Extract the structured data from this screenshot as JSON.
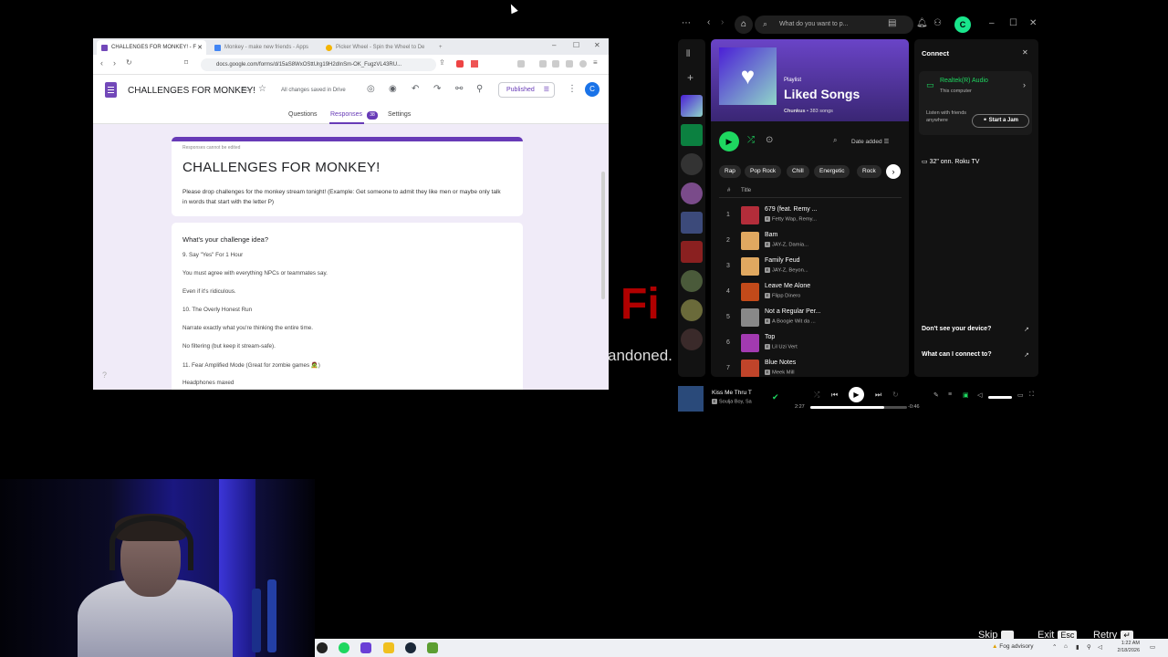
{
  "chrome": {
    "tabs": [
      {
        "label": "CHALLENGES FOR MONKEY! - F",
        "favicon_color": "#7248b9"
      },
      {
        "label": "Monkey - make new friends - Apps",
        "favicon_color": "#4285f4"
      },
      {
        "label": "Picker Wheel - Spin the Wheel to De",
        "favicon_color": "#f4b400"
      }
    ],
    "new_tab": "+",
    "url": "docs.google.com/forms/d/15aS8WxOSttUrg19H2dInSm-OK_FugzVL43RU..."
  },
  "forms": {
    "title": "CHALLENGES FOR MONKEY!",
    "saved_status": "All changes saved in Drive",
    "publish_label": "Published",
    "account_initial": "C",
    "tabs": {
      "questions": "Questions",
      "responses": "Responses",
      "responses_count": "38",
      "settings": "Settings"
    },
    "notice": "Responses cannot be edited",
    "form_heading": "CHALLENGES FOR MONKEY!",
    "description": "Please drop challenges for the monkey stream tonight! (Example: Get someone to admit they like men or maybe only talk in words that start with the letter P)",
    "question": "What's your challenge idea?",
    "answer_lines": [
      "9. Say \"Yes\" For 1 Hour",
      "You must agree with everything NPCs or teammates say.",
      "Even if it's ridiculous.",
      "10. The Overly Honest Run",
      "Narrate exactly what you're thinking the entire time.",
      "No filtering (but keep it stream-safe).",
      "11. Fear Amplified Mode (Great for zombie games 🧟)",
      "Headphones maxed"
    ]
  },
  "background_text": {
    "fragment_red": "Fi",
    "fragment_white": "andoned."
  },
  "spotify": {
    "search_placeholder": "What do you want to p...",
    "avatar_initial": "C",
    "playlist": {
      "type": "Playlist",
      "title": "Liked Songs",
      "owner": "Chunkus",
      "count": "383 songs"
    },
    "sort_label": "Date added",
    "chips": [
      "Rap",
      "Pop Rock",
      "Chill",
      "Energetic",
      "Rock"
    ],
    "col_hash": "#",
    "col_title": "Title",
    "tracks": [
      {
        "num": "1",
        "title": "679 (feat. Remy ...",
        "artist": "Fetty Wap, Remy...",
        "color": "#b32d3a"
      },
      {
        "num": "2",
        "title": "Bam",
        "artist": "JAY-Z, Damia...",
        "color": "#e0a860"
      },
      {
        "num": "3",
        "title": "Family Feud",
        "artist": "JAY-Z, Beyon...",
        "color": "#e0a860"
      },
      {
        "num": "4",
        "title": "Leave Me Alone",
        "artist": "Flipp Dinero",
        "color": "#c24a1a"
      },
      {
        "num": "5",
        "title": "Not a Regular Per...",
        "artist": "A Boogie Wit da ...",
        "color": "#888888"
      },
      {
        "num": "6",
        "title": "Top",
        "artist": "Lil Uzi Vert",
        "color": "#a23ab0"
      },
      {
        "num": "7",
        "title": "Blue Notes",
        "artist": "Meek Mill",
        "color": "#c0442a"
      }
    ],
    "connect": {
      "title": "Connect",
      "current_device": "Realtek(R) Audio",
      "current_sub": "This computer",
      "listen_text": "Listen with friends anywhere",
      "jam_button": "Start a Jam",
      "other_device": "32\" onn. Roku TV",
      "help1": "Don't see your device?",
      "help2": "What can I connect to?"
    },
    "now_playing": {
      "title": "Kiss Me Thru T",
      "artist": "Soulja Boy, Sa",
      "elapsed": "2:27",
      "remaining": "-0:46",
      "progress": 0.76
    },
    "accent": "#1ed760"
  },
  "overlay": {
    "skip": "Skip",
    "exit": "Exit",
    "exit_key": "Esc",
    "retry": "Retry"
  },
  "taskbar": {
    "weather": "Fog advisory",
    "time": "1:22 AM",
    "date": "2/18/2026"
  }
}
